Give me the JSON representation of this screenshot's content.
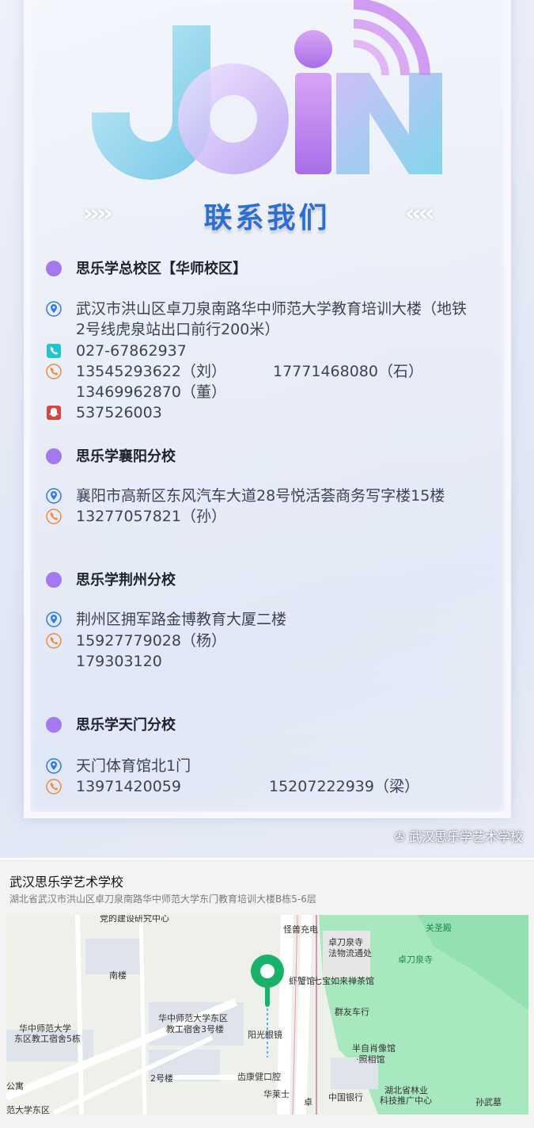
{
  "poster": {
    "join_word": "JOiN",
    "heading": "联系我们",
    "chevrons_left": "››››",
    "chevrons_right": "‹‹‹‹",
    "watermark": "武汉思乐学艺术学校"
  },
  "campuses": [
    {
      "title": "思乐学总校区【华师校区】",
      "address": "武汉市洪山区卓刀泉南路华中师范大学教育培训大楼（地铁2号线虎泉站出口前行200米）",
      "landline": "027-67862937",
      "mobile_1": "13545293622（刘）",
      "mobile_2": "17771468080（石）",
      "mobile_3": "13469962870（董）",
      "qq": "537526003"
    },
    {
      "title": "思乐学襄阳分校",
      "address": "襄阳市高新区东风汽车大道28号悦活荟商务写字楼15楼",
      "mobile_1": "13277057821（孙）"
    },
    {
      "title": "思乐学荆州分校",
      "address": "荆州区拥军路金博教育大厦二楼",
      "mobile_1": "15927779028（杨）",
      "extra": "179303120"
    },
    {
      "title": "思乐学天门分校",
      "address": "天门体育馆北1门",
      "mobile_1": "13971420059",
      "mobile_2": "15207222939（梁）"
    }
  ],
  "colors": {
    "accent_purple": "#a479f0",
    "heading_blue": "#2d6fd1",
    "pin_blue": "#2f7be6",
    "phone_orange": "#f08a3c",
    "landline_cyan": "#22c4cf",
    "qq_red": "#d8453d",
    "map_marker_green": "#19b26a"
  },
  "map_card": {
    "name": "武汉思乐学艺术学校",
    "address": "湖北省武汉市洪山区卓刀泉南路华中师范大学东门教育培训大楼B栋5-6层",
    "labels": {
      "l1": "党的建设研究中心",
      "l2": "怪兽充电",
      "l3": "关圣殿",
      "l4": "卓刀泉寺",
      "l5": "卓刀泉寺",
      "l6": "法物流通处",
      "l7": "南楼",
      "l8": "虾蟹馆",
      "l9": "七宝如来禅茶馆",
      "l10": "群友车行",
      "l11": "华中师范大学东区",
      "l12": "教工宿舍3号楼",
      "l13": "华中师范大学",
      "l14": "东区教工宿舍5栋",
      "l15": "阳光眼镜",
      "l16": "半自肖像馆",
      "l17": "·照相馆",
      "l18": "2号楼",
      "l19": "齿康健口腔",
      "l20": "中国银行",
      "l21": "湖北省林业",
      "l22": "科技推广中心",
      "l23": "孙武墓",
      "l24": "华莱士",
      "l25": "公寓",
      "l26": "范大学东区",
      "l27": "卓"
    }
  }
}
